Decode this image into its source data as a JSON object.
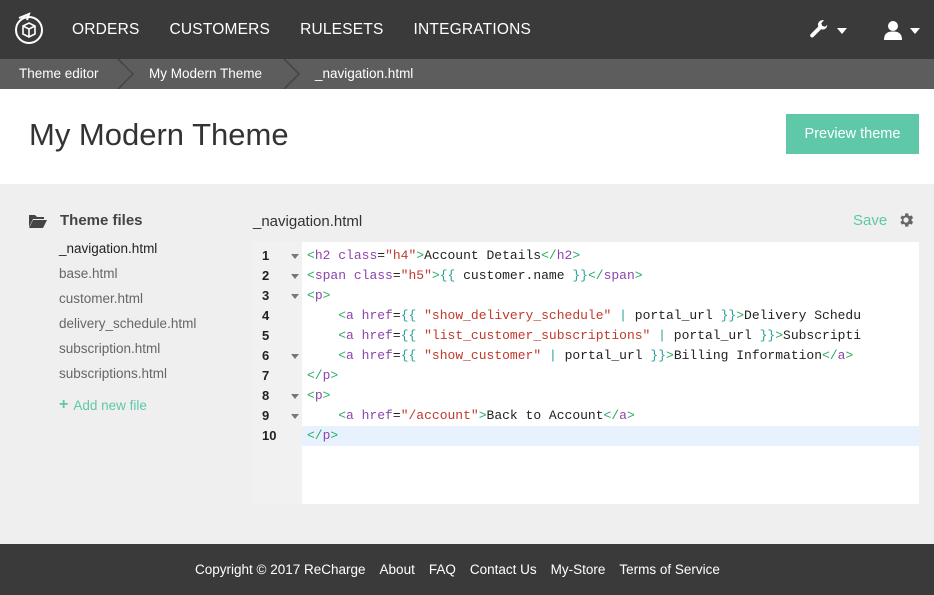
{
  "nav": {
    "links": [
      "ORDERS",
      "CUSTOMERS",
      "RULESETS",
      "INTEGRATIONS"
    ],
    "tools_icon": "wrench-icon",
    "user_icon": "user-icon"
  },
  "breadcrumb": [
    "Theme editor",
    "My Modern Theme",
    "_navigation.html"
  ],
  "header": {
    "title": "My Modern Theme",
    "preview_label": "Preview theme"
  },
  "sidebar": {
    "heading": "Theme files",
    "files": [
      "_navigation.html",
      "base.html",
      "customer.html",
      "delivery_schedule.html",
      "subscription.html",
      "subscriptions.html"
    ],
    "active_file": "_navigation.html",
    "add_label": "Add new file"
  },
  "editor": {
    "filename": "_navigation.html",
    "save_label": "Save",
    "line_numbers": [
      "1",
      "2",
      "3",
      "4",
      "5",
      "6",
      "7",
      "8",
      "9",
      "10"
    ],
    "lines": [
      "<h2 class=\"h4\">Account Details</h2>",
      "<span class=\"h5\">{{ customer.name }}</span>",
      "<p>",
      "    <a href={{ \"show_delivery_schedule\" | portal_url }}>Delivery Schedu",
      "    <a href={{ \"list_customer_subscriptions\" | portal_url }}>Subscripti",
      "    <a href={{ \"show_customer\" | portal_url }}>Billing Information</a>",
      "</p>",
      "<p>",
      "    <a href=\"/account\">Back to Account</a>",
      "</p>"
    ]
  },
  "footer": {
    "copyright": "Copyright © 2017 ReCharge",
    "links": [
      "About",
      "FAQ",
      "Contact Us",
      "My-Store",
      "Terms of Service"
    ]
  },
  "colors": {
    "accent": "#5ec8a9",
    "nav_bg": "#3a3a3a",
    "crumb_bg": "#5d5d5d"
  }
}
